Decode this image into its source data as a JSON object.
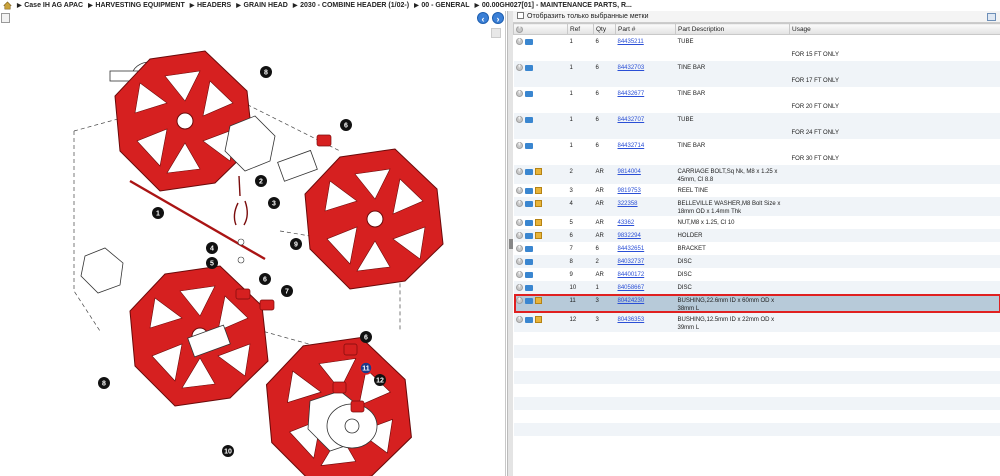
{
  "breadcrumb": {
    "items": [
      "Case IH AG APAC",
      "HARVESTING EQUIPMENT",
      "HEADERS",
      "GRAIN HEAD",
      "2030 - COMBINE HEADER (1/02-)",
      "00 - GENERAL",
      "00.00GH027[01] - MAINTENANCE PARTS, R..."
    ]
  },
  "filter": {
    "label": "Отобразить только выбранные метки"
  },
  "table": {
    "headers": [
      "",
      "Ref",
      "Qty",
      "Part #",
      "Part Description",
      "Usage"
    ],
    "rows": [
      {
        "ref": "1",
        "qty": "6",
        "part": "84435211",
        "desc": "TUBE",
        "usage": "FOR 15 FT ONLY",
        "box": false
      },
      {
        "ref": "1",
        "qty": "6",
        "part": "84432703",
        "desc": "TINE BAR",
        "usage": "FOR 17 FT ONLY",
        "box": false
      },
      {
        "ref": "1",
        "qty": "6",
        "part": "84432677",
        "desc": "TINE BAR",
        "usage": "FOR 20 FT ONLY",
        "box": false
      },
      {
        "ref": "1",
        "qty": "6",
        "part": "84432707",
        "desc": "TUBE",
        "usage": "FOR 24 FT ONLY",
        "box": false
      },
      {
        "ref": "1",
        "qty": "6",
        "part": "84432714",
        "desc": "TINE BAR",
        "usage": "FOR 30 FT ONLY",
        "box": false
      },
      {
        "ref": "2",
        "qty": "AR",
        "part": "9814004",
        "desc": "CARRIAGE BOLT,Sq Nk, M8 x 1.25 x 45mm, Cl 8.8",
        "usage": "",
        "box": true
      },
      {
        "ref": "3",
        "qty": "AR",
        "part": "9819753",
        "desc": "REEL TINE",
        "usage": "",
        "box": true
      },
      {
        "ref": "4",
        "qty": "AR",
        "part": "322358",
        "desc": "BELLEVILLE WASHER,M8 Bolt Size x 18mm OD x 1.4mm Thk",
        "usage": "",
        "box": true
      },
      {
        "ref": "5",
        "qty": "AR",
        "part": "43362",
        "desc": "NUT,M8 x 1.25, Cl 10",
        "usage": "",
        "box": true
      },
      {
        "ref": "6",
        "qty": "AR",
        "part": "9832294",
        "desc": "HOLDER",
        "usage": "",
        "box": true
      },
      {
        "ref": "7",
        "qty": "6",
        "part": "84432651",
        "desc": "BRACKET",
        "usage": "",
        "box": false
      },
      {
        "ref": "8",
        "qty": "2",
        "part": "84032737",
        "desc": "DISC",
        "usage": "",
        "box": false
      },
      {
        "ref": "9",
        "qty": "AR",
        "part": "84400172",
        "desc": "DISC",
        "usage": "",
        "box": false
      },
      {
        "ref": "10",
        "qty": "1",
        "part": "84058667",
        "desc": "DISC",
        "usage": "",
        "box": false
      },
      {
        "ref": "11",
        "qty": "3",
        "part": "80424230",
        "desc": "BUSHING,22.6mm ID x 60mm OD x 38mm L",
        "usage": "",
        "box": true,
        "selected": true
      },
      {
        "ref": "12",
        "qty": "3",
        "part": "80436353",
        "desc": "BUSHING,12.5mm ID x 22mm OD x 39mm L",
        "usage": "",
        "box": true
      }
    ]
  },
  "diagram": {
    "callouts": [
      "1",
      "2",
      "3",
      "4",
      "5",
      "6",
      "6",
      "6",
      "7",
      "8",
      "8",
      "9",
      "10",
      "11",
      "12"
    ]
  },
  "colors": {
    "part_red": "#d62020",
    "selected_row": "#b7cad9",
    "highlight": "#e02020",
    "link": "#2a4fd6"
  }
}
